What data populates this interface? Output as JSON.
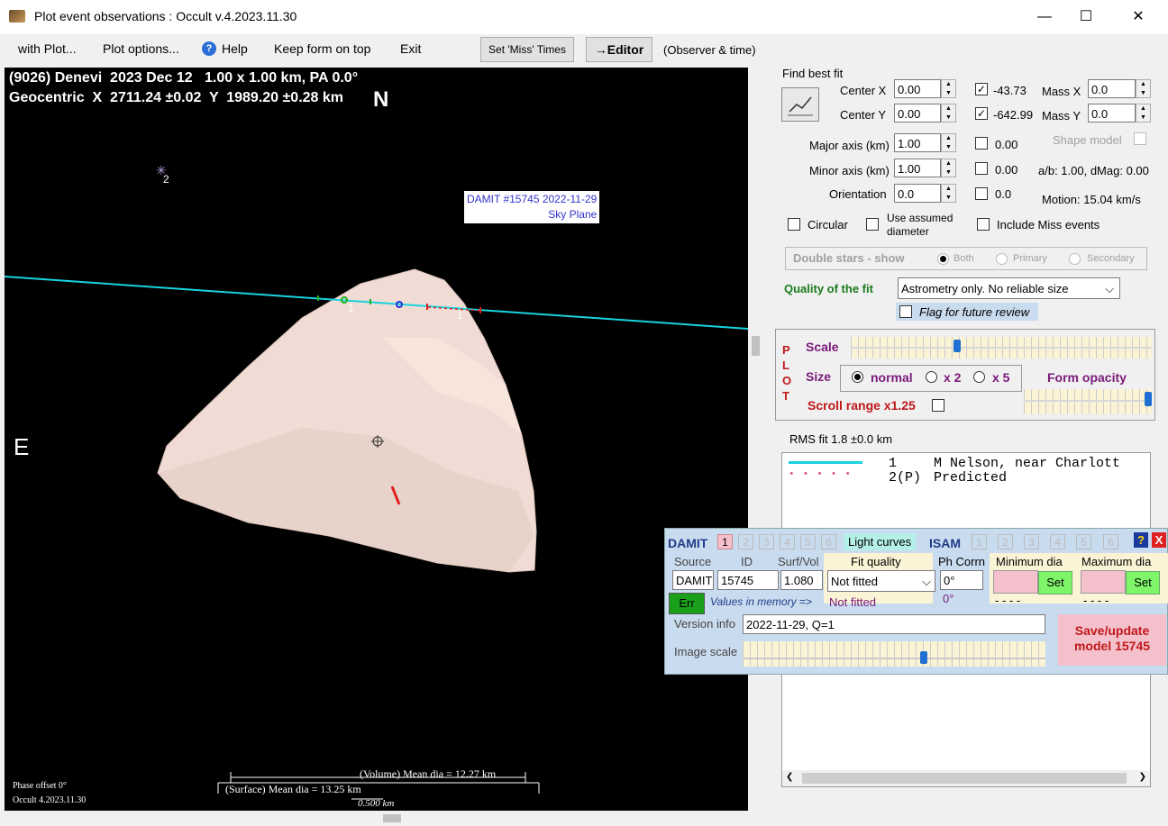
{
  "window": {
    "title": "Plot event observations : Occult v.4.2023.11.30",
    "minimize": "—",
    "maximize": "☐",
    "close": "✕"
  },
  "menu": {
    "with_plot": "with Plot...",
    "plot_options": "Plot options...",
    "help": "Help",
    "help_icon": "?",
    "keep_form_on_top": "Keep form on top",
    "exit": "Exit",
    "set_miss_times": "Set 'Miss' Times",
    "editor": "→Editor",
    "observer_time": "(Observer & time)"
  },
  "plot": {
    "header_line1": "(9026) Denevi  2023 Dec 12   1.00 x 1.00 km, PA 0.0°",
    "header_line2": "Geocentric  X  2711.24 ±0.02  Y  1989.20 ±0.28 km",
    "north": "N",
    "east": "E",
    "star_label": "2",
    "damit_label_line1": "DAMIT #15745 2022-11-29",
    "damit_label_line2": "Sky Plane",
    "chord_label_1a": "1",
    "chord_label_1b": "1",
    "volume_mean": "(Volume) Mean dia = 12.27 km",
    "surface_mean": "(Surface) Mean dia = 13.25 km",
    "scale_bar": "0.500 km",
    "phase_offset": "Phase offset 0°",
    "occult_version": "Occult 4.2023.11.30",
    "colors": {
      "chord": "#19d3e0",
      "shape": "#f0dcd4",
      "background": "#000000"
    }
  },
  "fit": {
    "find_best_fit": "Find best fit",
    "center_x_label": "Center X",
    "center_x": "0.00",
    "center_x_checked": true,
    "center_x_result": "-43.73",
    "mass_x_label": "Mass X",
    "mass_x": "0.0",
    "center_y_label": "Center Y",
    "center_y": "0.00",
    "center_y_checked": true,
    "center_y_result": "-642.99",
    "mass_y_label": "Mass Y",
    "mass_y": "0.0",
    "shape_model_label": "Shape model",
    "major_axis_label": "Major axis (km)",
    "major_axis": "1.00",
    "major_result": "0.00",
    "minor_axis_label": "Minor axis (km)",
    "minor_axis": "1.00",
    "minor_result": "0.00",
    "ab_dmag": "a/b: 1.00, dMag: 0.00",
    "orientation_label": "Orientation",
    "orientation": "0.0",
    "orientation_result": "0.0",
    "motion": "Motion: 15.04 km/s",
    "circular": "Circular",
    "use_assumed_diameter": "Use assumed diameter",
    "include_miss_events": "Include Miss events",
    "double_stars": "Double stars - show",
    "both": "Both",
    "primary": "Primary",
    "secondary": "Secondary",
    "quality_label": "Quality of the fit",
    "quality_value": "Astrometry only. No reliable size",
    "flag_future": "Flag for future review"
  },
  "plot_group": {
    "vertical": [
      "P",
      "L",
      "O",
      "T"
    ],
    "scale": "Scale",
    "scale_level": 0.35,
    "size": "Size",
    "normal": "normal",
    "x2": "x 2",
    "x5": "x 5",
    "form_opacity": "Form opacity",
    "opacity_level": 1.0,
    "scroll_range": "Scroll range x1.25"
  },
  "rms_fit": "RMS fit  1.8 ±0.0 km",
  "legend": [
    {
      "num": "1",
      "text": "M Nelson, near Charlott"
    },
    {
      "num": "2(P)",
      "text": "Predicted"
    }
  ],
  "damit": {
    "title": "DAMIT",
    "models": [
      "1",
      "2",
      "3",
      "4",
      "5",
      "6"
    ],
    "light_curves": "Light curves",
    "isam": "ISAM",
    "isam_models": [
      "1",
      "2",
      "3",
      "4",
      "5",
      "6"
    ],
    "help_icon": "?",
    "close_icon": "X",
    "source_label": "Source",
    "id_label": "ID",
    "surfvol_label": "Surf/Vol",
    "fit_quality_label": "Fit quality",
    "phcorrn_label": "Ph Corrn",
    "min_dia_label": "Minimum dia",
    "max_dia_label": "Maximum dia",
    "source": "DAMIT",
    "id": "15745",
    "surfvol": "1.080",
    "fit_quality": "Not fitted",
    "phcorrn": "0°",
    "set": "Set",
    "err": "Err",
    "values_in_memory": "Values in memory =>",
    "mem_fit_quality": "Not fitted",
    "mem_phcorrn": "0°",
    "mem_min": "- - - -",
    "mem_max": "- - - -",
    "version_label": "Version info",
    "version": "2022-11-29, Q=1",
    "image_scale_label": "Image scale",
    "image_scale_level": 0.6,
    "save_update": "Save/update model 15745"
  }
}
